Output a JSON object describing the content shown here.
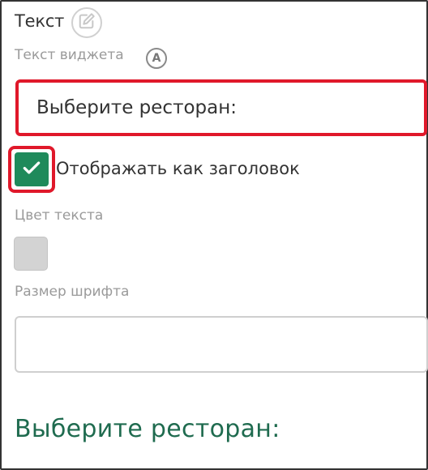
{
  "panel": {
    "title": "Текст",
    "edit_icon": "pencil-square-icon",
    "widget_text_label": "Текст виджета",
    "auto_badge": "A",
    "widget_text_value": "Выберите ресторан:",
    "header_checkbox": {
      "checked": true,
      "label": "Отображать как заголовок",
      "icon": "checkmark-icon"
    },
    "text_color_label": "Цвет текста",
    "text_color_value": "#d3d3d3",
    "font_size_label": "Размер шрифта",
    "font_size_value": "",
    "preview_text": "Выберите ресторан:"
  },
  "colors": {
    "accent_green": "#1f8a5b",
    "preview_text": "#1f6b4f",
    "highlight_red": "#e0182a"
  }
}
